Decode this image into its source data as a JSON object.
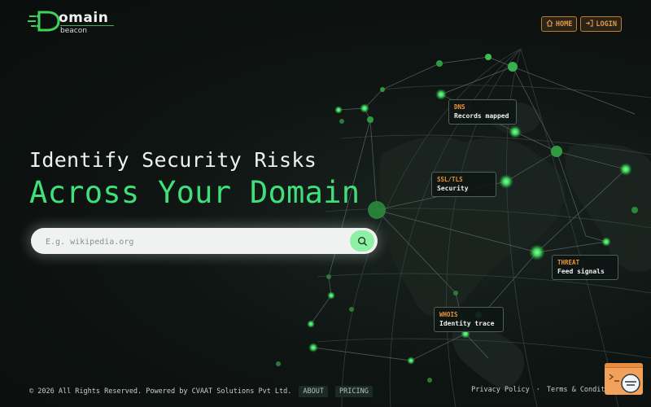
{
  "brand": {
    "name_main": "omain",
    "name_sub": "beacon"
  },
  "nav": {
    "home": "HOME",
    "login": "LOGIN"
  },
  "hero": {
    "line1": "Identify Security Risks",
    "line2": "Across Your Domain"
  },
  "search": {
    "placeholder": "E.g. wikipedia.org",
    "value": ""
  },
  "cards": {
    "dns": {
      "title": "DNS",
      "subtitle": "Records mapped"
    },
    "ssl": {
      "title": "SSL/TLS",
      "subtitle": "Security"
    },
    "threat": {
      "title": "THREAT",
      "subtitle": "Feed signals"
    },
    "whois": {
      "title": "WHOIS",
      "subtitle": "Identity trace"
    }
  },
  "footer": {
    "copyright": "© 2026 All Rights Reserved. Powered by CVAAT Solutions Pvt Ltd.",
    "about": "ABOUT",
    "pricing": "PRICING",
    "privacy": "Privacy Policy",
    "separator": "·",
    "terms": "Terms & Conditions"
  },
  "colors": {
    "accent_green": "#3fe07a",
    "accent_orange": "#ee9434",
    "background": "#0c1110"
  }
}
